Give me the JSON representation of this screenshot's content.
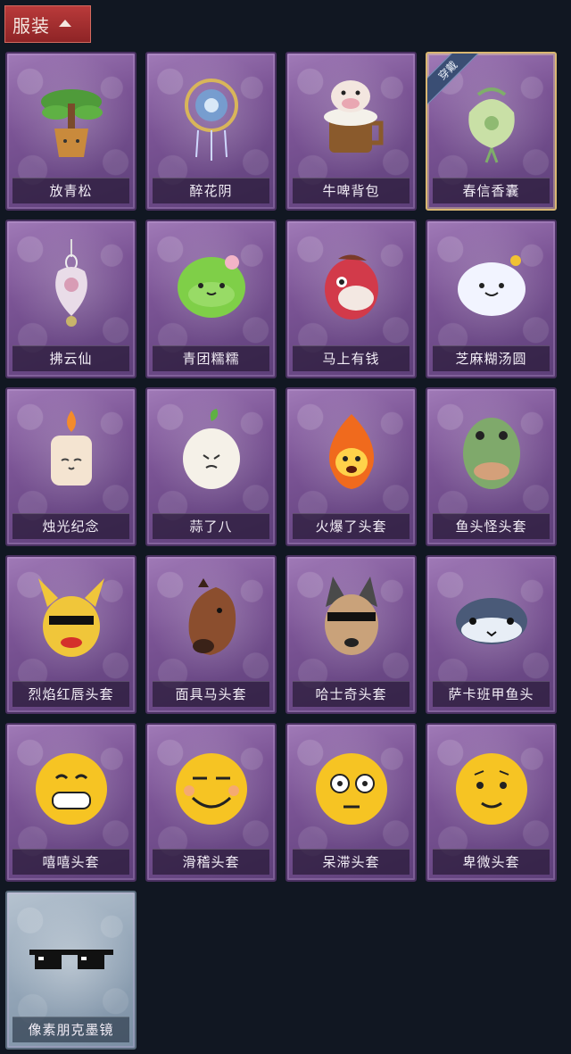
{
  "header": {
    "tab_label": "服装",
    "tab_icon": "chevron-up-icon"
  },
  "items": [
    {
      "name": "放青松",
      "icon": "pine-bonsai-icon",
      "equipped": false
    },
    {
      "name": "醉花阴",
      "icon": "dreamcatcher-icon",
      "equipped": false
    },
    {
      "name": "牛啤背包",
      "icon": "cow-beer-mug-icon",
      "equipped": false
    },
    {
      "name": "春信香囊",
      "icon": "sachet-pouch-icon",
      "equipped": true,
      "badge": "穿戴"
    },
    {
      "name": "拂云仙",
      "icon": "cloud-charm-pendant-icon",
      "equipped": false
    },
    {
      "name": "青团糯糯",
      "icon": "green-dumpling-icon",
      "equipped": false
    },
    {
      "name": "马上有钱",
      "icon": "red-horse-icon",
      "equipped": false
    },
    {
      "name": "芝麻糊汤圆",
      "icon": "sesame-dumpling-icon",
      "equipped": false
    },
    {
      "name": "烛光纪念",
      "icon": "candle-icon",
      "equipped": false
    },
    {
      "name": "蒜了八",
      "icon": "garlic-icon",
      "equipped": false
    },
    {
      "name": "火爆了头套",
      "icon": "fire-head-icon",
      "equipped": false
    },
    {
      "name": "鱼头怪头套",
      "icon": "fish-head-mask-icon",
      "equipped": false
    },
    {
      "name": "烈焰红唇头套",
      "icon": "yellow-mouse-mask-icon",
      "equipped": false
    },
    {
      "name": "面具马头套",
      "icon": "horse-head-mask-icon",
      "equipped": false
    },
    {
      "name": "哈士奇头套",
      "icon": "husky-head-mask-icon",
      "equipped": false
    },
    {
      "name": "萨卡班甲鱼头",
      "icon": "sacabambaspis-head-icon",
      "equipped": false
    },
    {
      "name": "嘻嘻头套",
      "icon": "grin-emoji-head-icon",
      "equipped": false
    },
    {
      "name": "滑稽头套",
      "icon": "silly-smile-emoji-head-icon",
      "equipped": false
    },
    {
      "name": "呆滞头套",
      "icon": "dazed-emoji-head-icon",
      "equipped": false
    },
    {
      "name": "卑微头套",
      "icon": "humble-emoji-head-icon",
      "equipped": false
    },
    {
      "name": "像素朋克墨镜",
      "icon": "pixel-sunglasses-icon",
      "equipped": false,
      "special": true
    }
  ],
  "colors": {
    "background": "#111722",
    "card_purple": "#7b5495",
    "card_special": "#93a5b7",
    "equipped_border": "#d9b772",
    "header_red": "#a8302f"
  }
}
